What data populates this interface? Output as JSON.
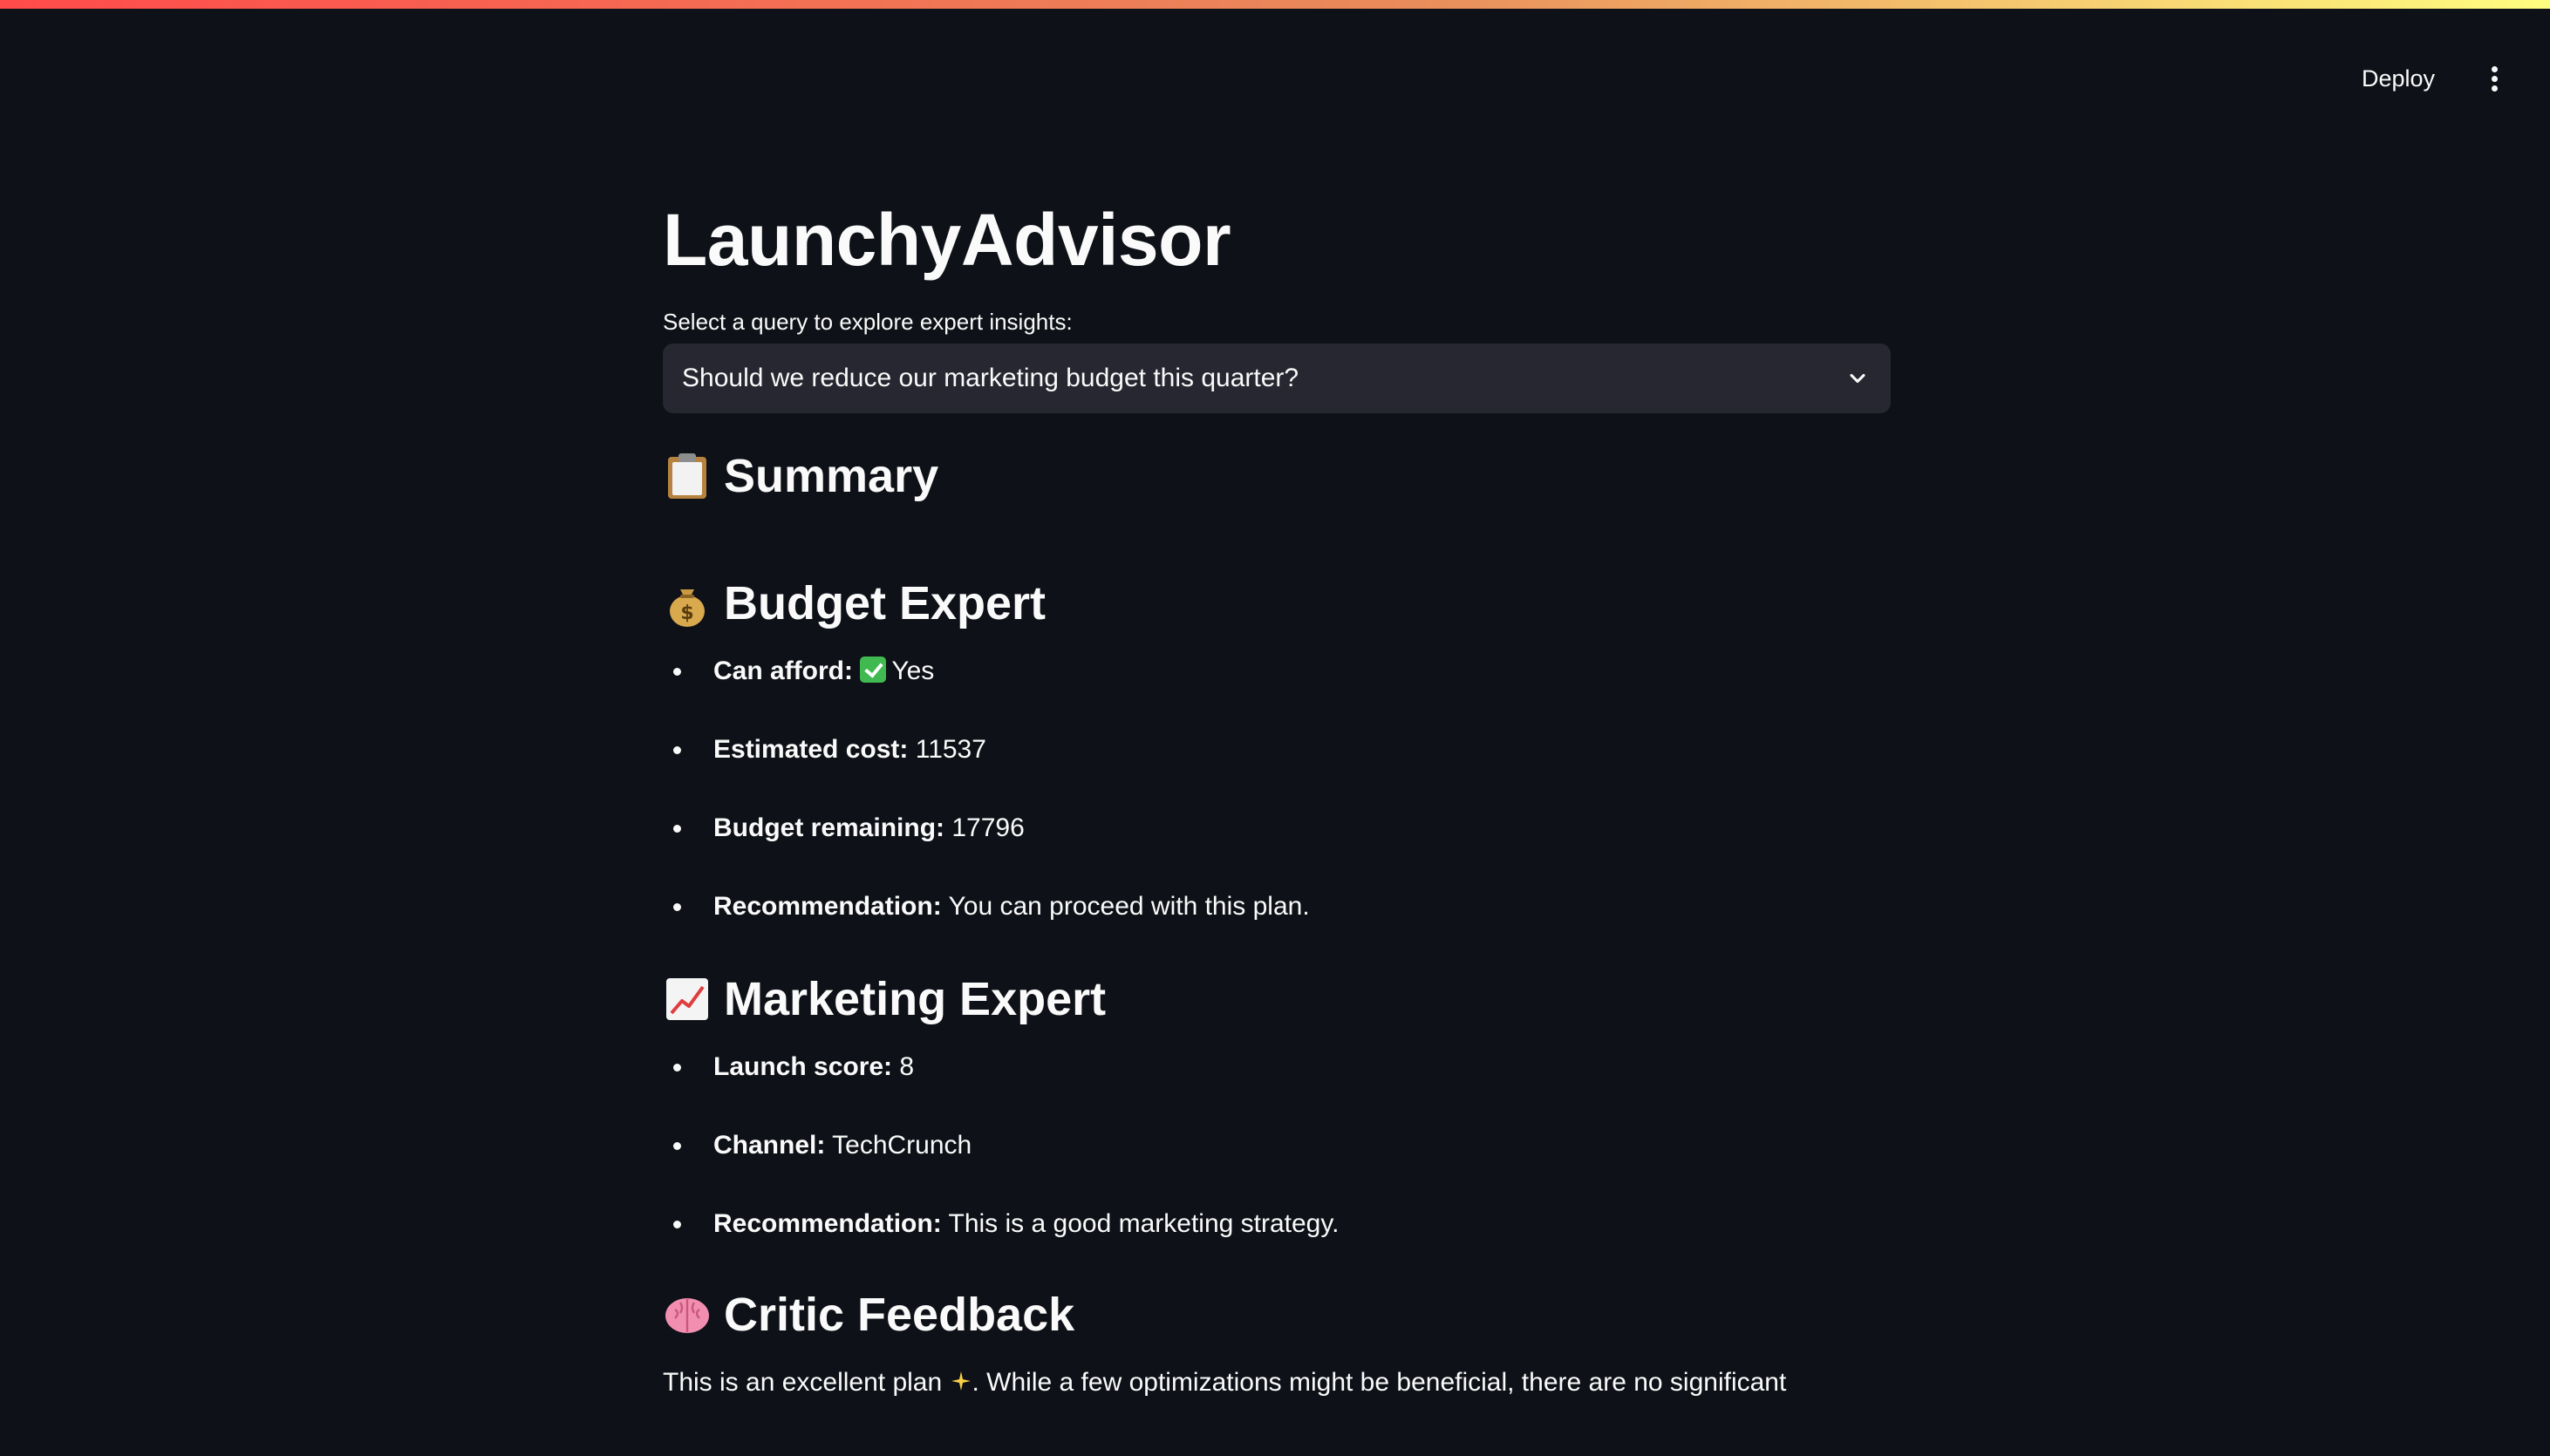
{
  "header": {
    "deploy_label": "Deploy",
    "menu_icon": "more-vertical-icon"
  },
  "main": {
    "title": "LaunchyAdvisor",
    "select_label": "Select a query to explore expert insights:",
    "select_value": "Should we reduce our marketing budget this quarter?",
    "sections": {
      "summary": {
        "icon": "clipboard-icon",
        "title": "Summary"
      },
      "budget": {
        "icon": "money-bag-icon",
        "title": "Budget Expert",
        "items": [
          {
            "label": "Can afford:",
            "value": "Yes",
            "icon": "check-mark-button-icon"
          },
          {
            "label": "Estimated cost:",
            "value": "11537"
          },
          {
            "label": "Budget remaining:",
            "value": "17796"
          },
          {
            "label": "Recommendation:",
            "value": "You can proceed with this plan."
          }
        ]
      },
      "marketing": {
        "icon": "chart-increasing-icon",
        "title": "Marketing Expert",
        "items": [
          {
            "label": "Launch score:",
            "value": "8"
          },
          {
            "label": "Channel:",
            "value": "TechCrunch"
          },
          {
            "label": "Recommendation:",
            "value": "This is a good marketing strategy."
          }
        ]
      },
      "critic": {
        "icon": "brain-icon",
        "title": "Critic Feedback",
        "text_before": "This is an excellent plan",
        "text_after": ". While a few optimizations might be beneficial, there are no significant"
      }
    }
  },
  "colors": {
    "background": "#0e1117",
    "select_background": "#262730",
    "text": "#fafafa",
    "top_gradient": [
      "#ff4b4b",
      "#fffd80"
    ]
  }
}
